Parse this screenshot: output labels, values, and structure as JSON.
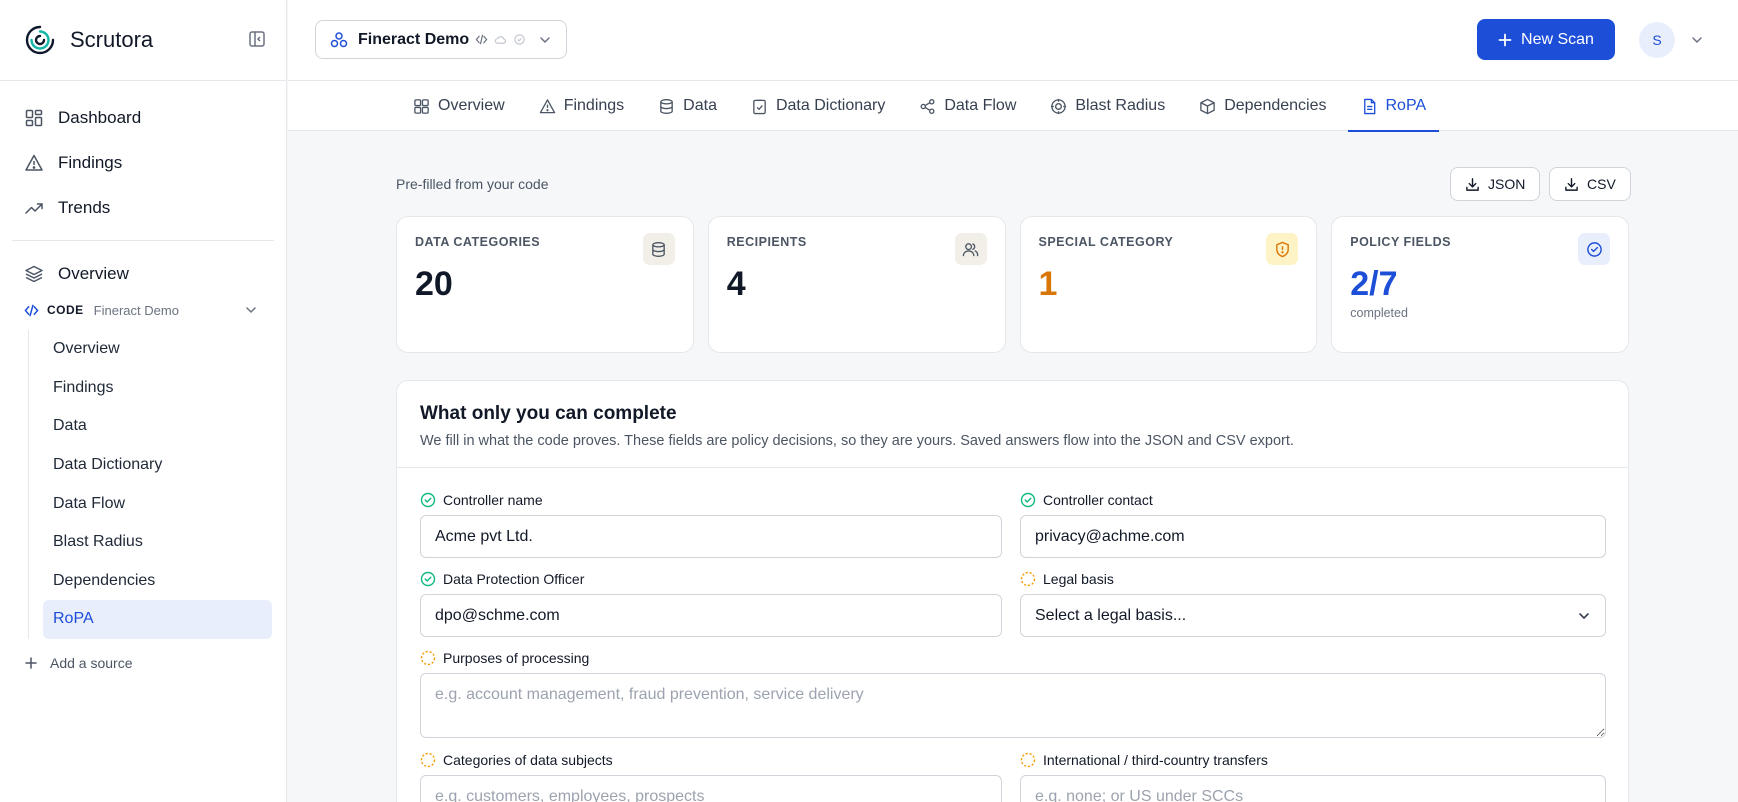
{
  "brand": {
    "name": "Scrutora"
  },
  "sidebar": {
    "nav": [
      {
        "label": "Dashboard"
      },
      {
        "label": "Findings"
      },
      {
        "label": "Trends"
      }
    ],
    "overview_label": "Overview",
    "code_section": {
      "label": "CODE",
      "project": "Fineract Demo"
    },
    "sub_items": [
      {
        "label": "Overview"
      },
      {
        "label": "Findings"
      },
      {
        "label": "Data"
      },
      {
        "label": "Data Dictionary"
      },
      {
        "label": "Data Flow"
      },
      {
        "label": "Blast Radius"
      },
      {
        "label": "Dependencies"
      },
      {
        "label": "RoPA"
      }
    ],
    "active_sub_item": "RoPA",
    "add_source_label": "Add a source"
  },
  "header": {
    "project_name": "Fineract Demo",
    "new_scan_label": "New Scan",
    "avatar_initial": "S"
  },
  "tabs": [
    {
      "label": "Overview",
      "icon": "grid-icon"
    },
    {
      "label": "Findings",
      "icon": "warning-icon"
    },
    {
      "label": "Data",
      "icon": "database-icon"
    },
    {
      "label": "Data Dictionary",
      "icon": "clipboard-check-icon"
    },
    {
      "label": "Data Flow",
      "icon": "share-icon"
    },
    {
      "label": "Blast Radius",
      "icon": "target-icon"
    },
    {
      "label": "Dependencies",
      "icon": "package-icon"
    },
    {
      "label": "RoPA",
      "icon": "document-icon"
    }
  ],
  "active_tab": "RoPA",
  "content": {
    "prefill_note": "Pre-filled from your code",
    "export_json_label": "JSON",
    "export_csv_label": "CSV",
    "stats": [
      {
        "label": "DATA CATEGORIES",
        "value": "20",
        "sub": "",
        "icon": "database-icon",
        "color": "#111827"
      },
      {
        "label": "RECIPIENTS",
        "value": "4",
        "sub": "",
        "icon": "users-icon",
        "color": "#111827"
      },
      {
        "label": "SPECIAL CATEGORY",
        "value": "1",
        "sub": "",
        "icon": "shield-alert-icon",
        "color": "#d97706"
      },
      {
        "label": "POLICY FIELDS",
        "value": "2/7",
        "sub": "completed",
        "icon": "check-circle-icon",
        "color": "#1d4ed8"
      }
    ],
    "form": {
      "title": "What only you can complete",
      "description": "We fill in what the code proves. These fields are policy decisions, so they are yours. Saved answers flow into the JSON and CSV export.",
      "fields": {
        "controller_name": {
          "label": "Controller name",
          "value": "Acme pvt Ltd.",
          "status": "complete"
        },
        "controller_contact": {
          "label": "Controller contact",
          "value": "privacy@achme.com",
          "status": "complete"
        },
        "dpo": {
          "label": "Data Protection Officer",
          "value": "dpo@schme.com",
          "status": "complete"
        },
        "legal_basis": {
          "label": "Legal basis",
          "value": "Select a legal basis...",
          "status": "pending"
        },
        "purposes": {
          "label": "Purposes of processing",
          "placeholder": "e.g. account management, fraud prevention, service delivery",
          "status": "pending"
        },
        "data_subjects": {
          "label": "Categories of data subjects",
          "placeholder": "e.g. customers, employees, prospects",
          "status": "pending"
        },
        "transfers": {
          "label": "International / third-country transfers",
          "placeholder": "e.g. none; or US under SCCs",
          "status": "pending"
        }
      }
    }
  },
  "colors": {
    "accent": "#1d4ed8",
    "complete": "#10b981",
    "pending": "#f59e0b",
    "special": "#d97706"
  }
}
